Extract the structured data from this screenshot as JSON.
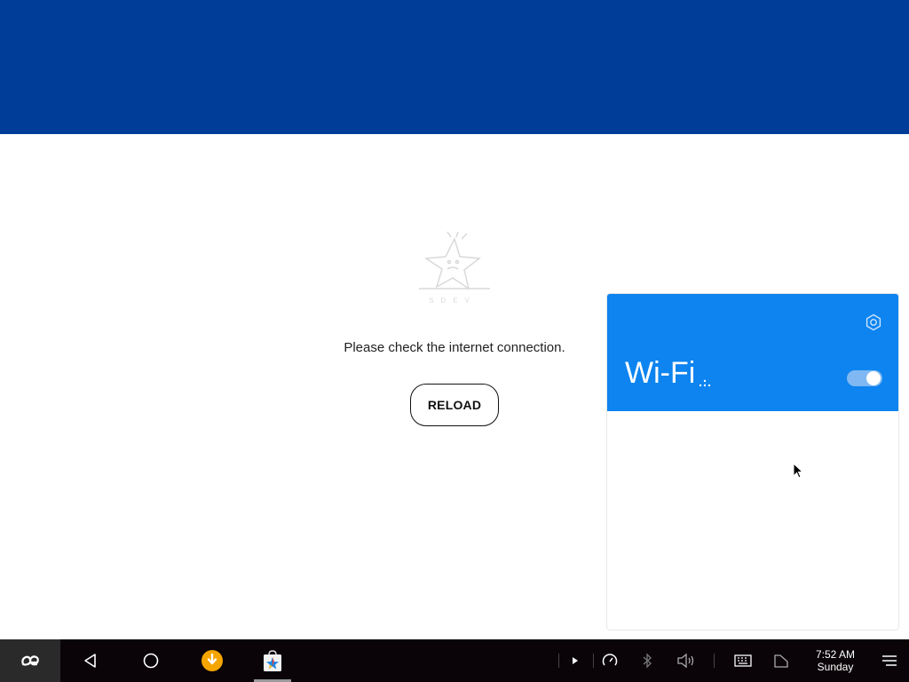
{
  "app": {
    "error_message": "Please check the internet connection.",
    "reload_label": "RELOAD",
    "illustration_caption": "SDEV",
    "colors": {
      "header": "#003d99",
      "background": "#ffffff"
    }
  },
  "wifi_panel": {
    "title": "Wi-Fi",
    "toggle_on": true,
    "settings_icon": "gear-icon",
    "accent": "#0d84f0"
  },
  "taskbar": {
    "time": "7:52 AM",
    "day": "Sunday",
    "icons": [
      "app-logo-icon",
      "back-icon",
      "home-icon",
      "download-app-icon",
      "store-app-icon",
      "play-icon",
      "speedometer-icon",
      "bluetooth-icon",
      "volume-icon",
      "keyboard-icon",
      "battery-icon",
      "menu-icon"
    ]
  }
}
